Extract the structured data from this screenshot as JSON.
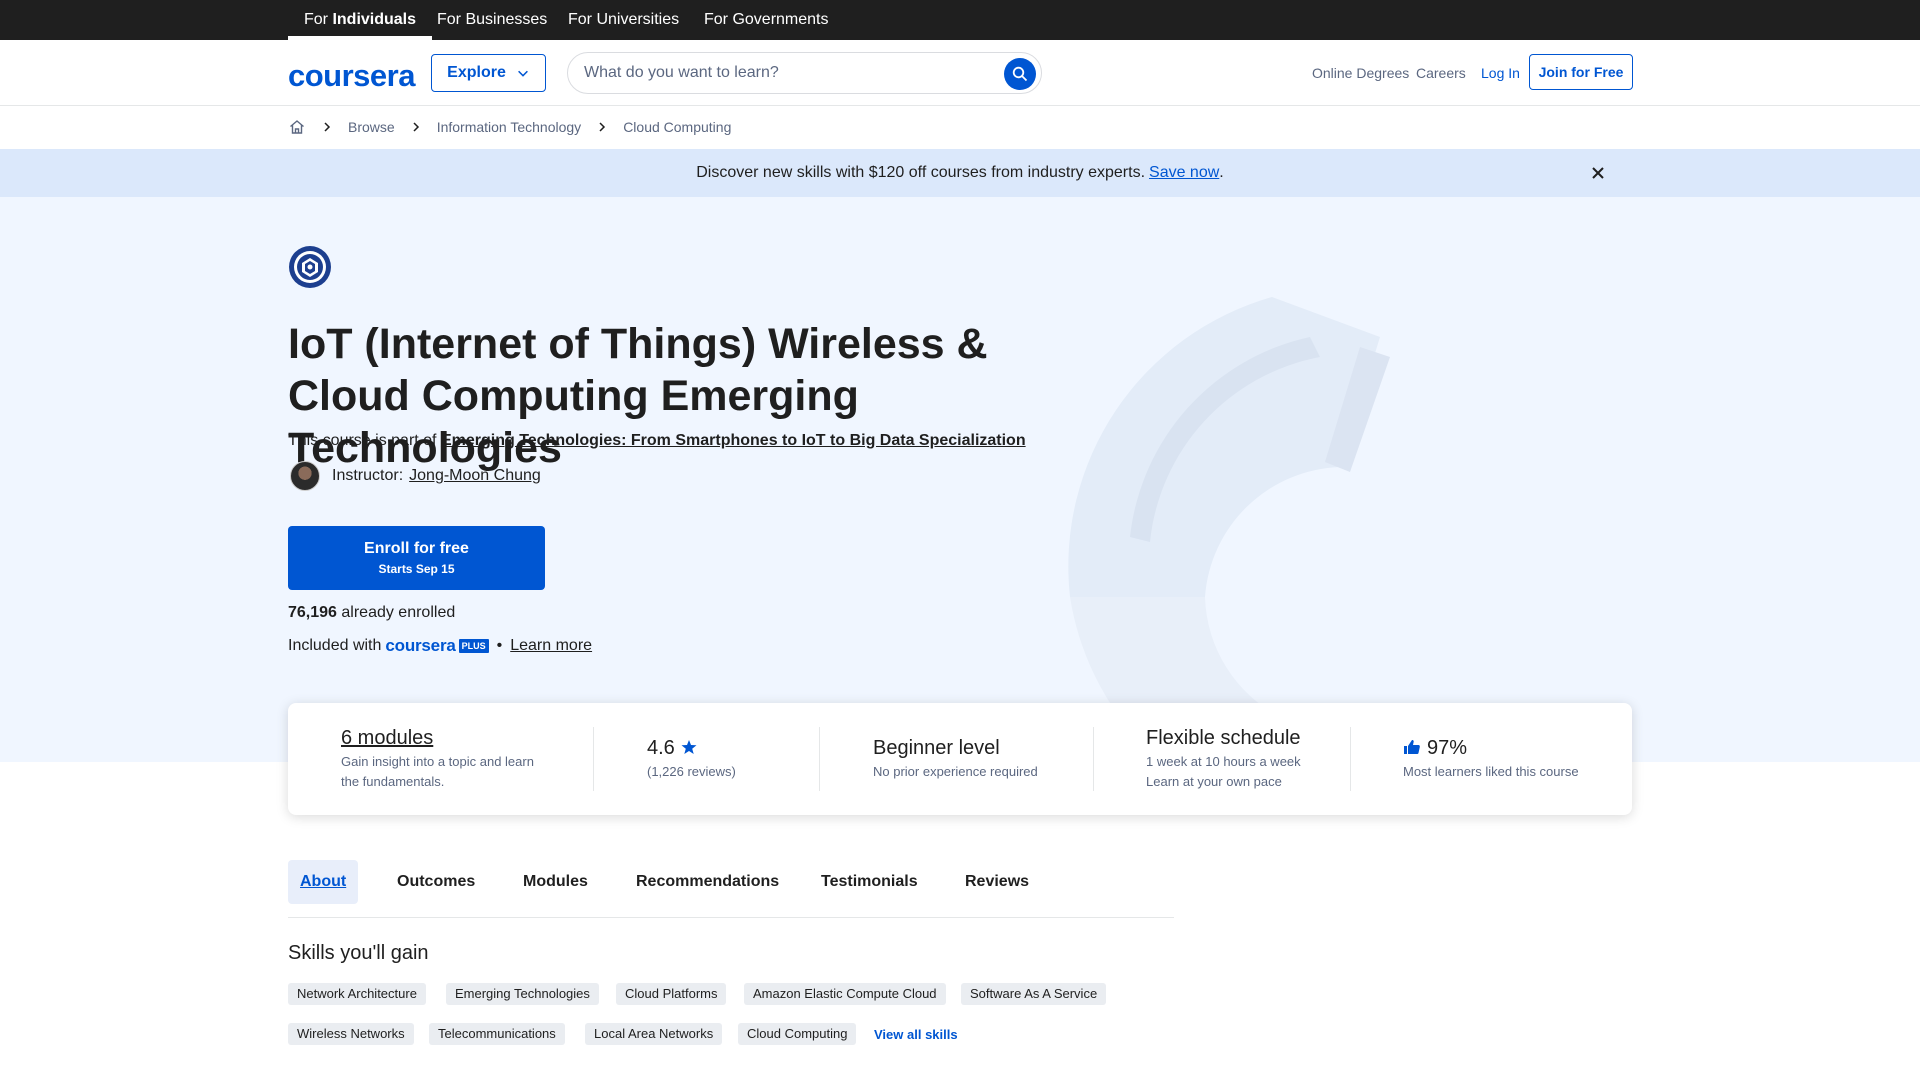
{
  "topbar": {
    "audiences": [
      {
        "pre": "For ",
        "bold": "Individuals"
      },
      {
        "label": "For Businesses"
      },
      {
        "label": "For Universities"
      },
      {
        "label": "For Governments"
      }
    ]
  },
  "header": {
    "logo": "coursera",
    "explore_label": "Explore",
    "search_placeholder": "What do you want to learn?",
    "links": [
      "Online Degrees",
      "Careers"
    ],
    "login_label": "Log In",
    "join_label": "Join for Free"
  },
  "breadcrumb": [
    "Browse",
    "Information Technology",
    "Cloud Computing"
  ],
  "promo": {
    "text": "Discover new skills with $120 off courses from industry experts.",
    "link": "Save now",
    "suffix": "."
  },
  "course": {
    "title": "IoT (Internet of Things) Wireless & Cloud Computing Emerging Technologies",
    "part_of_prefix": "This course is part of",
    "specialization": "Emerging Technologies: From Smartphones to IoT to Big Data Specialization",
    "instructor_label": "Instructor:",
    "instructor_name": "Jong-Moon Chung",
    "enroll_label": "Enroll for free",
    "enroll_sub": "Starts Sep 15",
    "enrolled_count": "76,196",
    "enrolled_suffix": " already enrolled",
    "included_prefix": "Included with",
    "plus_word": "coursera",
    "plus_badge": "PLUS",
    "dot": "•",
    "learn_more": "Learn more"
  },
  "stats": {
    "modules": {
      "title": "6 modules",
      "desc1": "Gain insight into a topic and learn",
      "desc2": "the fundamentals."
    },
    "rating": {
      "value": "4.6",
      "reviews": "(1,226 reviews)"
    },
    "level": {
      "title": "Beginner level",
      "desc": "No prior experience required"
    },
    "schedule": {
      "title": "Flexible schedule",
      "desc1": "1 week at 10 hours a week",
      "desc2": "Learn at your own pace"
    },
    "liked": {
      "value": "97%",
      "desc": "Most learners liked this course"
    }
  },
  "tabs": [
    "About",
    "Outcomes",
    "Modules",
    "Recommendations",
    "Testimonials",
    "Reviews"
  ],
  "skills": {
    "title": "Skills you'll gain",
    "row1": [
      "Network Architecture",
      "Emerging Technologies",
      "Cloud Platforms",
      "Amazon Elastic Compute Cloud",
      "Software As A Service"
    ],
    "row2": [
      "Wireless Networks",
      "Telecommunications",
      "Local Area Networks",
      "Cloud Computing"
    ],
    "view_all": "View all skills"
  },
  "colors": {
    "brand": "#0056d2",
    "hero_bg": "#f0f6ff",
    "promo_bg": "#dbe8fb",
    "topbar_bg": "#1f1f1f"
  },
  "icons": [
    "chevron-down-icon",
    "search-icon",
    "home-icon",
    "chevron-right-icon",
    "close-icon",
    "star-icon",
    "thumbs-up-icon",
    "university-seal-icon"
  ]
}
